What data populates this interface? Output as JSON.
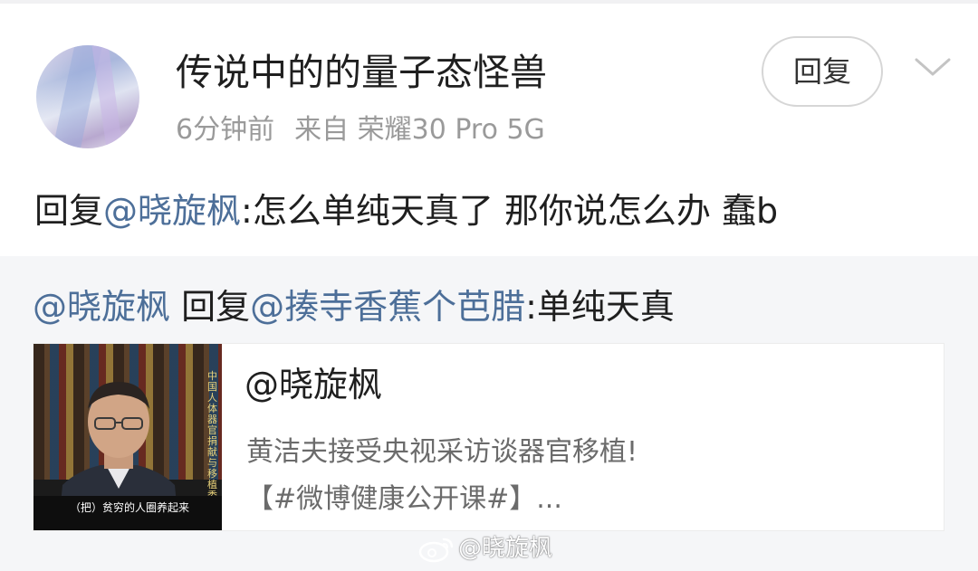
{
  "post": {
    "username": "传说中的的量子态怪兽",
    "time": "6分钟前",
    "source": "来自 荣耀30 Pro 5G",
    "reply_button": "回复",
    "comment": {
      "prefix": "回复",
      "mention": "@晓旋枫",
      "text": ":怎么单纯天真了 那你说怎么办 蠢b"
    }
  },
  "quoted": {
    "author": "@晓旋枫",
    "reply_word": " 回复",
    "mention": "@揍寺香蕉个芭腊",
    "text": ":单纯天真"
  },
  "card": {
    "title": "@晓旋枫",
    "desc_line1": "黄洁夫接受央视采访谈器官移植!",
    "desc_line2": "【#微博健康公开课#】...",
    "thumb_caption": "（把）贫穷的人圈养起来",
    "thumb_side_text": "中国人体器官捐献与移植委员会主任 黄洁夫"
  },
  "watermark": "@晓旋枫",
  "colors": {
    "link": "#4d6f99",
    "text": "#1f1f1f",
    "meta": "#9a9a9a",
    "quote_bg": "#f5f6f8"
  },
  "icons": {
    "more": "chevron-down-icon",
    "watermark_logo": "weibo-logo-icon"
  }
}
